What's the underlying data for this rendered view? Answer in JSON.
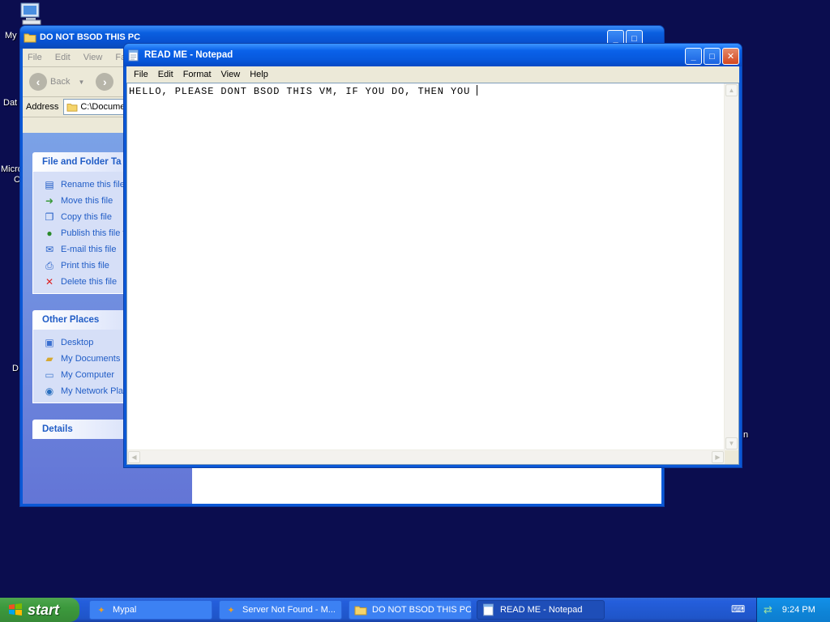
{
  "desktop": {
    "icons": [
      {
        "label": "My"
      },
      {
        "label": "Dat"
      },
      {
        "label": "Micro"
      },
      {
        "label": "C"
      },
      {
        "label": "D"
      },
      {
        "label": "n"
      }
    ]
  },
  "explorer": {
    "title": "DO NOT BSOD THIS PC",
    "menu": [
      "File",
      "Edit",
      "View",
      "Fa"
    ],
    "toolbar": {
      "back_label": "Back"
    },
    "address": {
      "label": "Address",
      "value": "C:\\Docume"
    },
    "file_tasks": {
      "title": "File and Folder Ta",
      "items": [
        "Rename this file",
        "Move this file",
        "Copy this file",
        "Publish this file t",
        "E-mail this file",
        "Print this file",
        "Delete this file"
      ]
    },
    "other_places": {
      "title": "Other Places",
      "items": [
        "Desktop",
        "My Documents",
        "My Computer",
        "My Network Plac"
      ]
    },
    "details": {
      "title": "Details"
    }
  },
  "notepad": {
    "title": "READ ME - Notepad",
    "menu": [
      "File",
      "Edit",
      "Format",
      "View",
      "Help"
    ],
    "content": "HELLO, PLEASE DONT BSOD THIS VM, IF YOU DO, THEN YOU "
  },
  "taskbar": {
    "start_label": "start",
    "buttons": [
      {
        "label": "Mypal",
        "active": false
      },
      {
        "label": "Server Not Found - M...",
        "active": false
      },
      {
        "label": "DO NOT BSOD THIS PC",
        "active": false
      },
      {
        "label": "READ ME - Notepad",
        "active": true
      }
    ],
    "clock": "9:24 PM"
  },
  "colors": {
    "desktop_bg": "#0b0d4f",
    "title_blue": "#0a5fe0",
    "task_link": "#215dc6",
    "start_green": "#3c9a3d"
  }
}
